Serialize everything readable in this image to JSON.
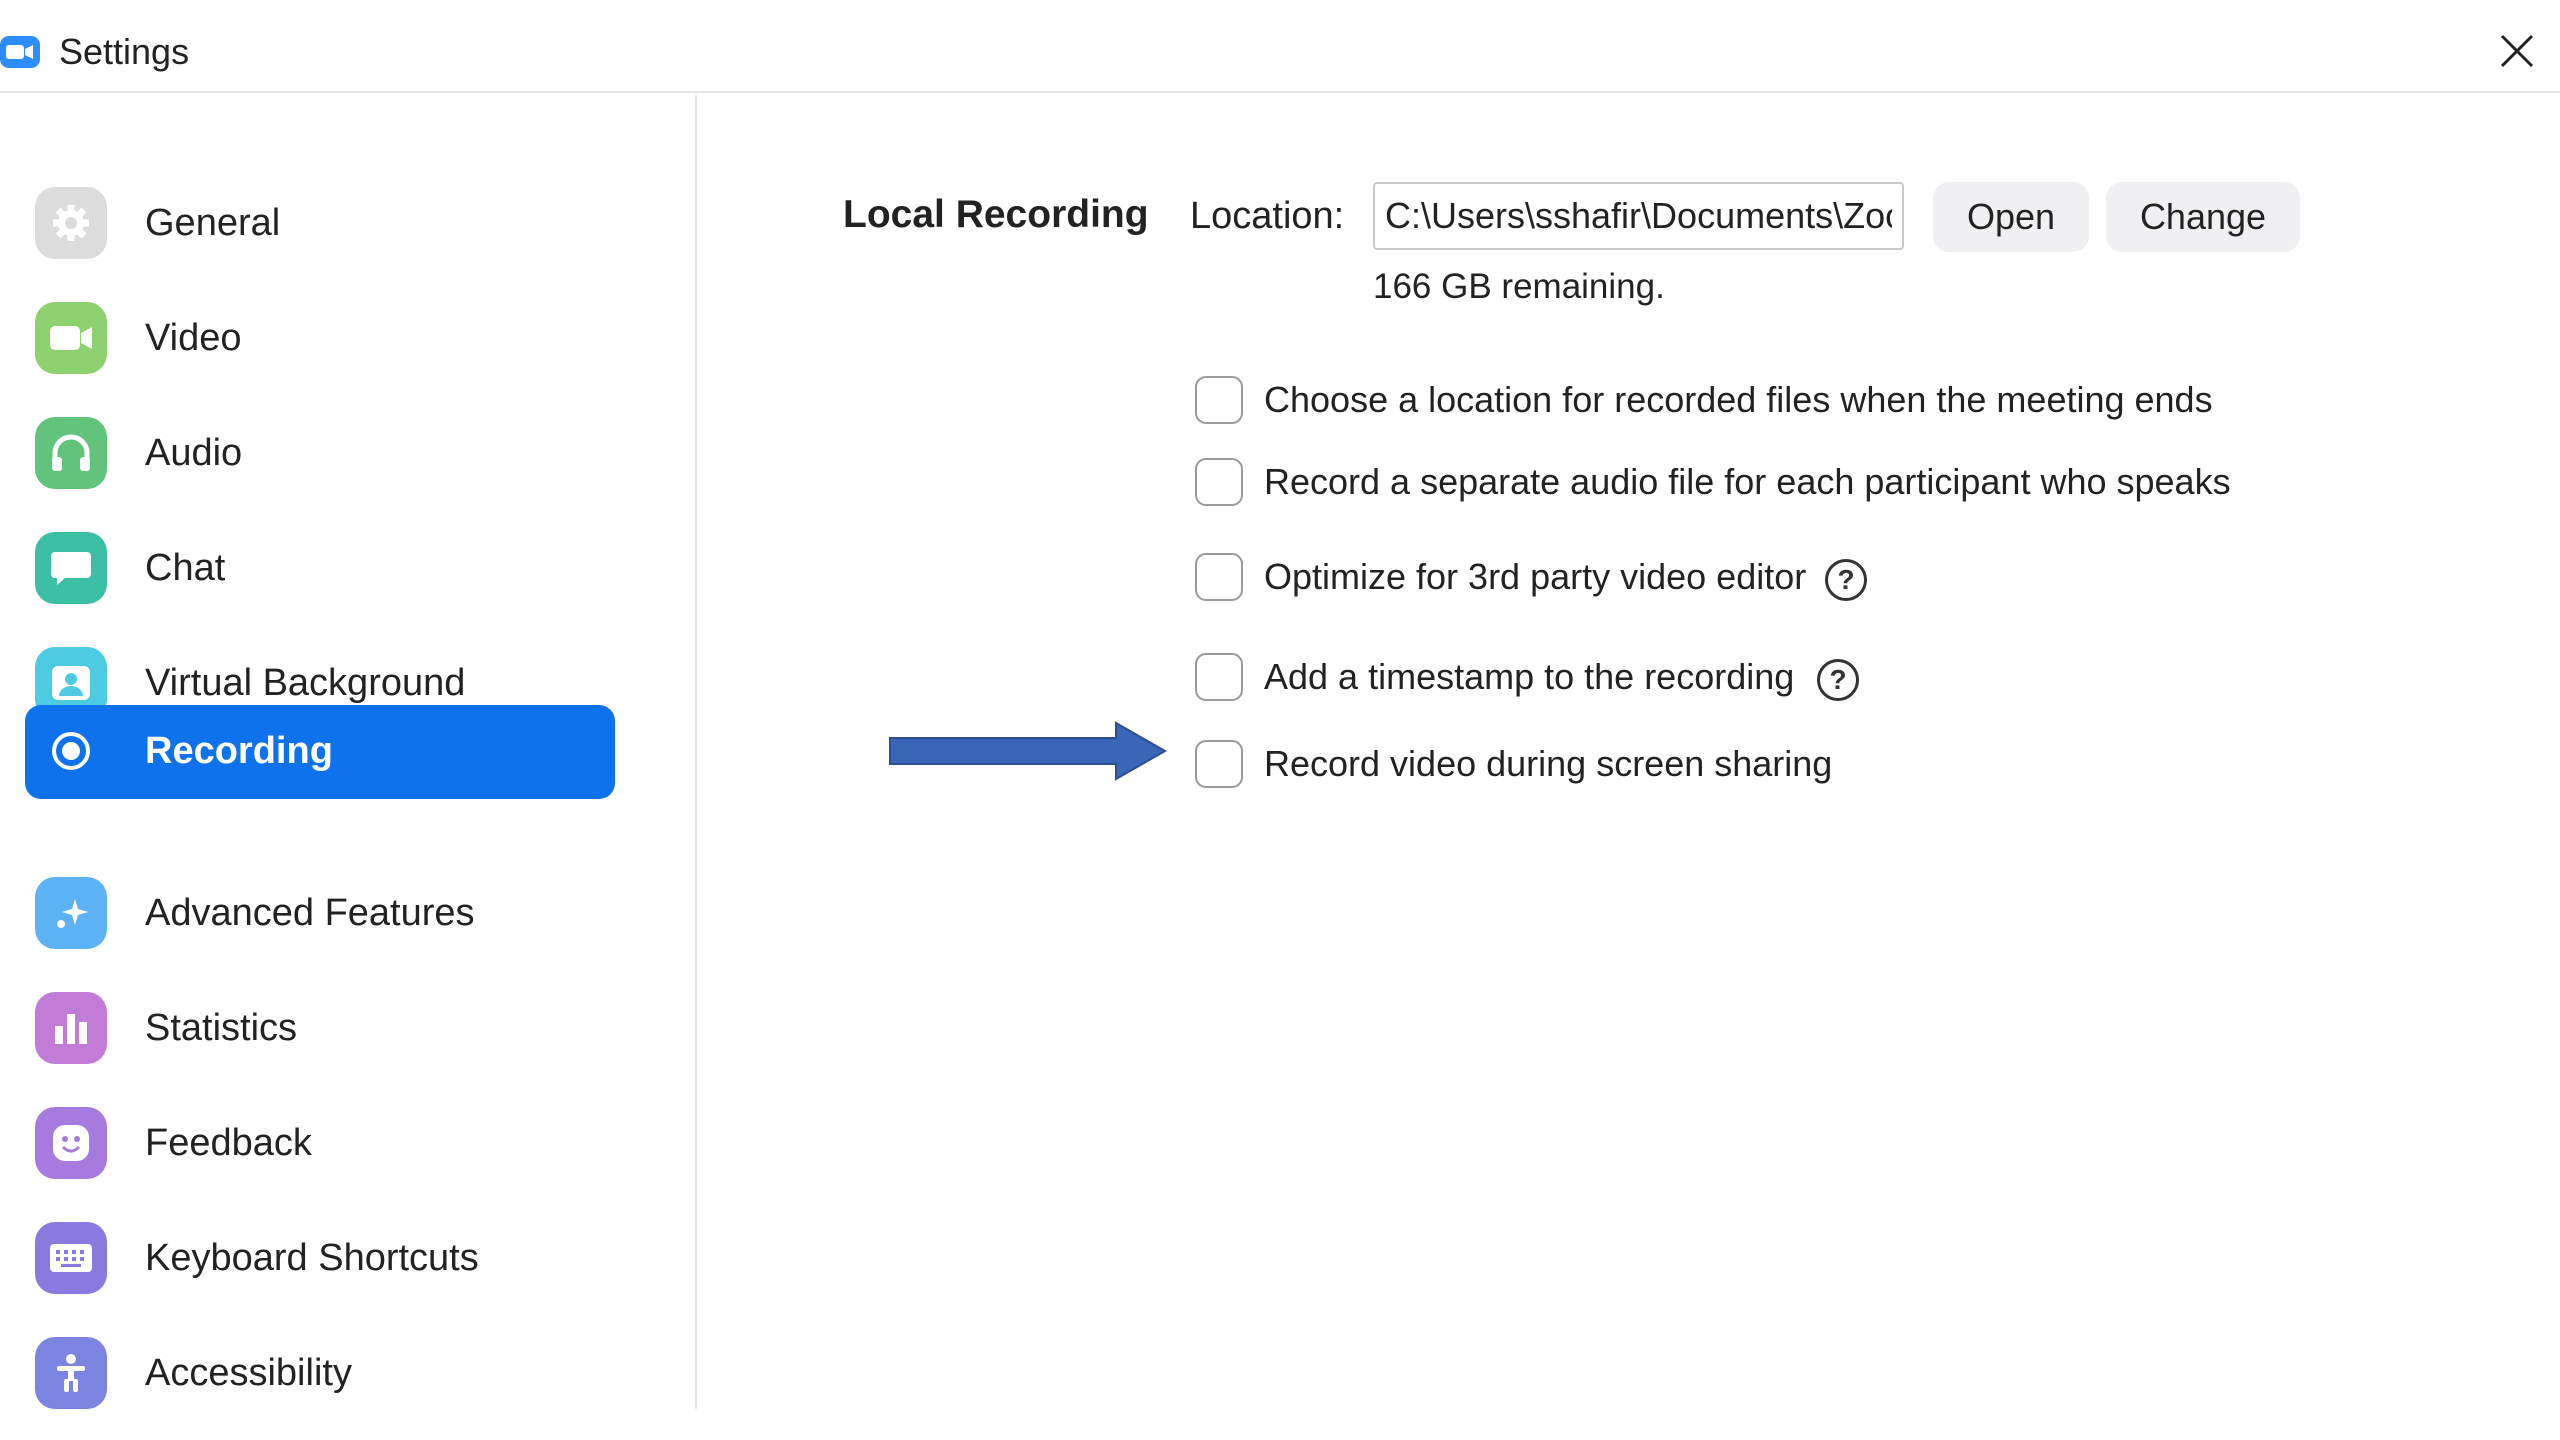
{
  "window": {
    "title": "Settings",
    "app_icon": "zoom-camera-icon",
    "close_icon": "close-icon"
  },
  "sidebar": {
    "items": [
      {
        "label": "General",
        "icon": "gear-icon",
        "color": "#d9d9d9",
        "active": false
      },
      {
        "label": "Video",
        "icon": "video-camera-icon",
        "color": "#8ed16f",
        "active": false
      },
      {
        "label": "Audio",
        "icon": "headphones-icon",
        "color": "#62c37c",
        "active": false
      },
      {
        "label": "Chat",
        "icon": "chat-bubble-icon",
        "color": "#3dbfa6",
        "active": false
      },
      {
        "label": "Virtual Background",
        "icon": "person-portrait-icon",
        "color": "#4ccbe2",
        "active": false
      },
      {
        "label": "Recording",
        "icon": "record-icon",
        "color": "#0e72ed",
        "active": true
      },
      {
        "label": "Advanced Features",
        "icon": "sparkle-icon",
        "color": "#5cb2f5",
        "active": false
      },
      {
        "label": "Statistics",
        "icon": "bar-chart-icon",
        "color": "#c27bd6",
        "active": false
      },
      {
        "label": "Feedback",
        "icon": "smiley-icon",
        "color": "#a77ae0",
        "active": false
      },
      {
        "label": "Keyboard Shortcuts",
        "icon": "keyboard-icon",
        "color": "#8a7ae0",
        "active": false
      },
      {
        "label": "Accessibility",
        "icon": "accessibility-icon",
        "color": "#7b84e0",
        "active": false
      }
    ]
  },
  "recording": {
    "section_title": "Local Recording",
    "location_label": "Location:",
    "location_value": "C:\\Users\\sshafir\\Documents\\Zoom",
    "open_label": "Open",
    "change_label": "Change",
    "remaining": "166 GB remaining.",
    "options": [
      {
        "label": "Choose a location for recorded files when the meeting ends",
        "checked": false,
        "help": false
      },
      {
        "label": "Record a separate audio file for each participant who speaks",
        "checked": false,
        "help": false
      },
      {
        "label": "Optimize for 3rd party video editor",
        "checked": false,
        "help": true
      },
      {
        "label": "Add a timestamp to the recording",
        "checked": false,
        "help": true
      },
      {
        "label": "Record video during screen sharing",
        "checked": false,
        "help": false
      }
    ],
    "help_glyph": "?"
  },
  "annotation": {
    "arrow": "right-arrow-icon",
    "arrow_color": "#3a66b8"
  },
  "colors": {
    "accent": "#0e72ed",
    "brand": "#2d8cff"
  }
}
